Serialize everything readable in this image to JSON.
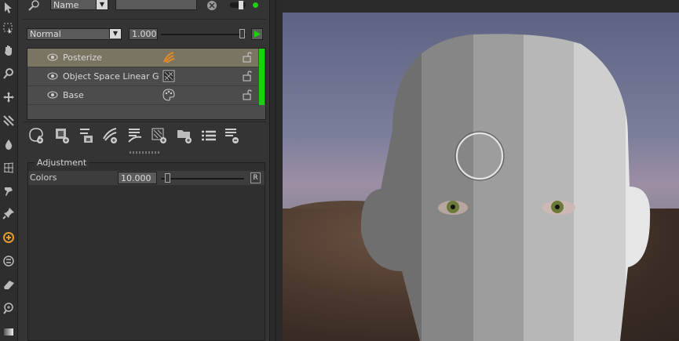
{
  "toolbar_left": {
    "tools": [
      "arrow-select-icon",
      "marquee-select-icon",
      "hand-icon",
      "zoom-icon",
      "move-icon",
      "transform-icon",
      "drop-icon",
      "grid-warp-icon",
      "paint-brush-icon",
      "pin-icon",
      "add-circle-icon",
      "swap-icon",
      "eraser-icon",
      "zoom-plus-icon",
      "gradient-icon"
    ]
  },
  "filter": {
    "mode": "Name",
    "query": ""
  },
  "blend": {
    "mode": "Normal",
    "opacity": "1.000"
  },
  "layers": [
    {
      "name": "Posterize",
      "selected": true,
      "type_icon": "posterize-icon"
    },
    {
      "name": "Object Space Linear G",
      "selected": false,
      "type_icon": "gradient-texture-icon"
    },
    {
      "name": "Base",
      "selected": false,
      "type_icon": "palette-icon"
    }
  ],
  "layer_buttons": [
    "add-material-icon",
    "add-image-icon",
    "add-adjustment-icon",
    "add-brush-icon",
    "add-fill-icon",
    "add-texture-icon",
    "add-folder-icon",
    "layer-list-icon",
    "remove-layer-icon"
  ],
  "adjustment": {
    "title": "Adjustment",
    "colors_label": "Colors",
    "colors_value": "10.000",
    "reset_label": "R"
  },
  "colors": {
    "accent_green": "#19d10f",
    "selected_layer": "#7a7562",
    "panel_bg": "#343434"
  }
}
